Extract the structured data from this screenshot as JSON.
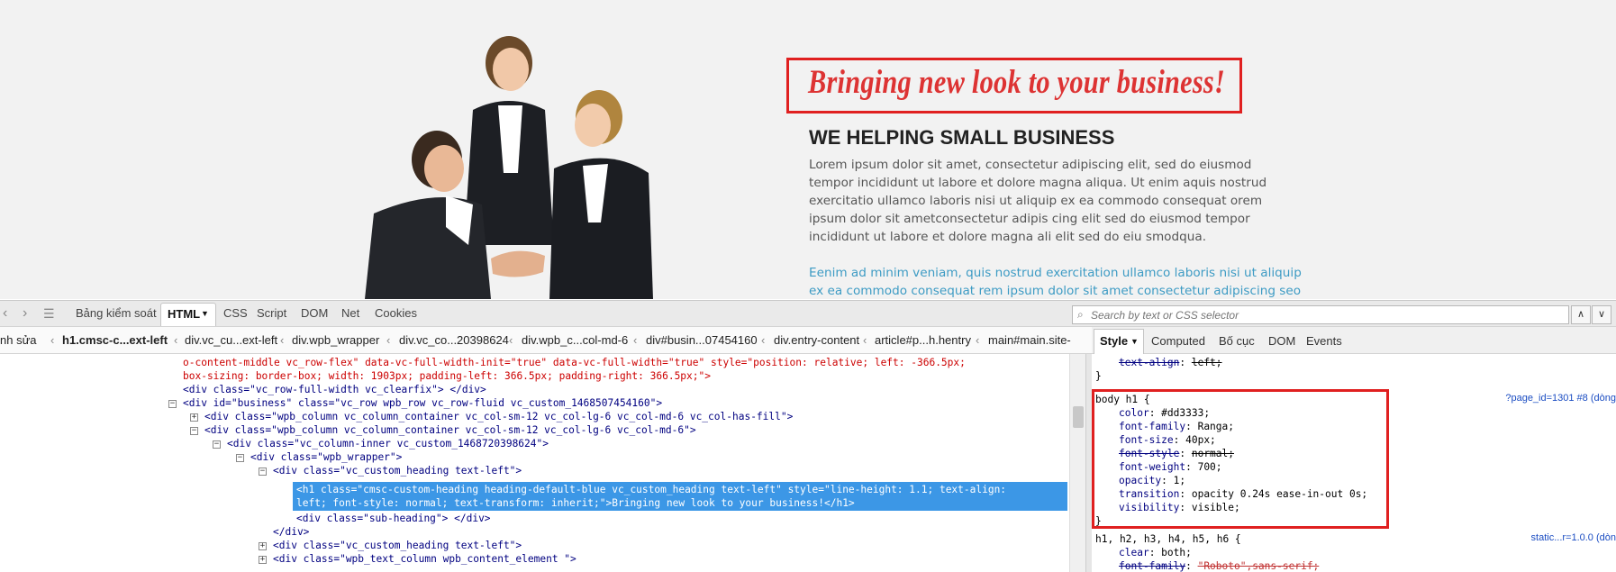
{
  "page": {
    "headline": "Bringing new look to your business!",
    "subheading": "WE HELPING SMALL BUSINESS",
    "paragraph": "Lorem ipsum dolor sit amet, consectetur adipiscing elit, sed do eiusmod tempor incididunt ut labore et dolore magna aliqua. Ut enim aquis nostrud exercitatio ullamco laboris nisi ut aliquip ex ea commodo consequat orem ipsum dolor sit ametconsectetur adipis cing elit sed do eiusmod tempor incididunt ut labore et dolore magna ali elit sed do eiu smodqua.",
    "paragraph_blue": "Eenim ad minim veniam, quis nostrud exercitation ullamco laboris nisi ut aliquip ex ea commodo consequat rem ipsum dolor sit amet consectetur adipiscing seo",
    "colors": {
      "headline": "#dd3333",
      "link": "#3d9bc4"
    }
  },
  "toolbar": {
    "inspect_label": "Bảng kiểm soát",
    "tabs": {
      "html": "HTML",
      "css": "CSS",
      "script": "Script",
      "dom": "DOM",
      "net": "Net",
      "cookies": "Cookies"
    },
    "search_placeholder": "Search by text or CSS selector"
  },
  "breadcrumb": {
    "edit": "nh sửa",
    "items": [
      "h1.cmsc-c...ext-left",
      "div.vc_cu...ext-left",
      "div.wpb_wrapper",
      "div.vc_co...20398624",
      "div.wpb_c...col-md-6",
      "div#busin...07454160",
      "div.entry-content",
      "article#p...h.hentry",
      "main#main.site-"
    ]
  },
  "side_tabs": {
    "style": "Style",
    "computed": "Computed",
    "layout": "Bố cục",
    "dom": "DOM",
    "events": "Events"
  },
  "html_tree": {
    "line1": "o-content-middle vc_row-flex\" data-vc-full-width-init=\"true\" data-vc-full-width=\"true\" style=\"position: relative; left: -366.5px;",
    "line2": "box-sizing: border-box; width: 1903px; padding-left: 366.5px; padding-right: 366.5px;\">",
    "line3": "<div class=\"vc_row-full-width vc_clearfix\"> </div>",
    "line4": "<div id=\"business\" class=\"vc_row wpb_row vc_row-fluid vc_custom_1468507454160\">",
    "line5": "<div class=\"wpb_column vc_column_container vc_col-sm-12 vc_col-lg-6 vc_col-md-6 vc_col-has-fill\">",
    "line6": "<div class=\"wpb_column vc_column_container vc_col-sm-12 vc_col-lg-6 vc_col-md-6\">",
    "line7": "<div class=\"vc_column-inner vc_custom_1468720398624\">",
    "line8": "<div class=\"wpb_wrapper\">",
    "line9": "<div class=\"vc_custom_heading text-left\">",
    "sel1": "<h1 class=\"cmsc-custom-heading heading-default-blue vc_custom_heading text-left\" style=\"line-height: 1.1; text-align:",
    "sel2": "left; font-style: normal; text-transform: inherit;\">Bringing new look to your business!</h1>",
    "line10": "<div class=\"sub-heading\"> </div>",
    "line11": "</div>",
    "line12": "<div class=\"vc_custom_heading text-left\">",
    "line13": "<div class=\"wpb_text_column wpb_content_element \">"
  },
  "style_pane": {
    "top_prop": "text-align",
    "top_val": "left;",
    "close0": "}",
    "selector": "body h1 {",
    "source1": "?page_id=1301 #8 (dòng",
    "props": [
      {
        "name": "color",
        "value": "#dd3333;",
        "overridden": false
      },
      {
        "name": "font-family",
        "value": "Ranga;",
        "overridden": false
      },
      {
        "name": "font-size",
        "value": "40px;",
        "overridden": false
      },
      {
        "name": "font-style",
        "value": "normal;",
        "overridden": true
      },
      {
        "name": "font-weight",
        "value": "700;",
        "overridden": false
      },
      {
        "name": "opacity",
        "value": "1;",
        "overridden": false
      },
      {
        "name": "transition",
        "value": "opacity 0.24s ease-in-out 0s;",
        "overridden": false
      },
      {
        "name": "visibility",
        "value": "visible;",
        "overridden": false
      }
    ],
    "close1": "}",
    "selector2": "h1, h2, h3, h4, h5, h6 {",
    "source2": "static...r=1.0.0 (dòn",
    "clear_prop": "clear",
    "clear_val": "both;",
    "ff_prop": "font-family",
    "ff_val": "\"Roboto\",sans-serif;"
  }
}
